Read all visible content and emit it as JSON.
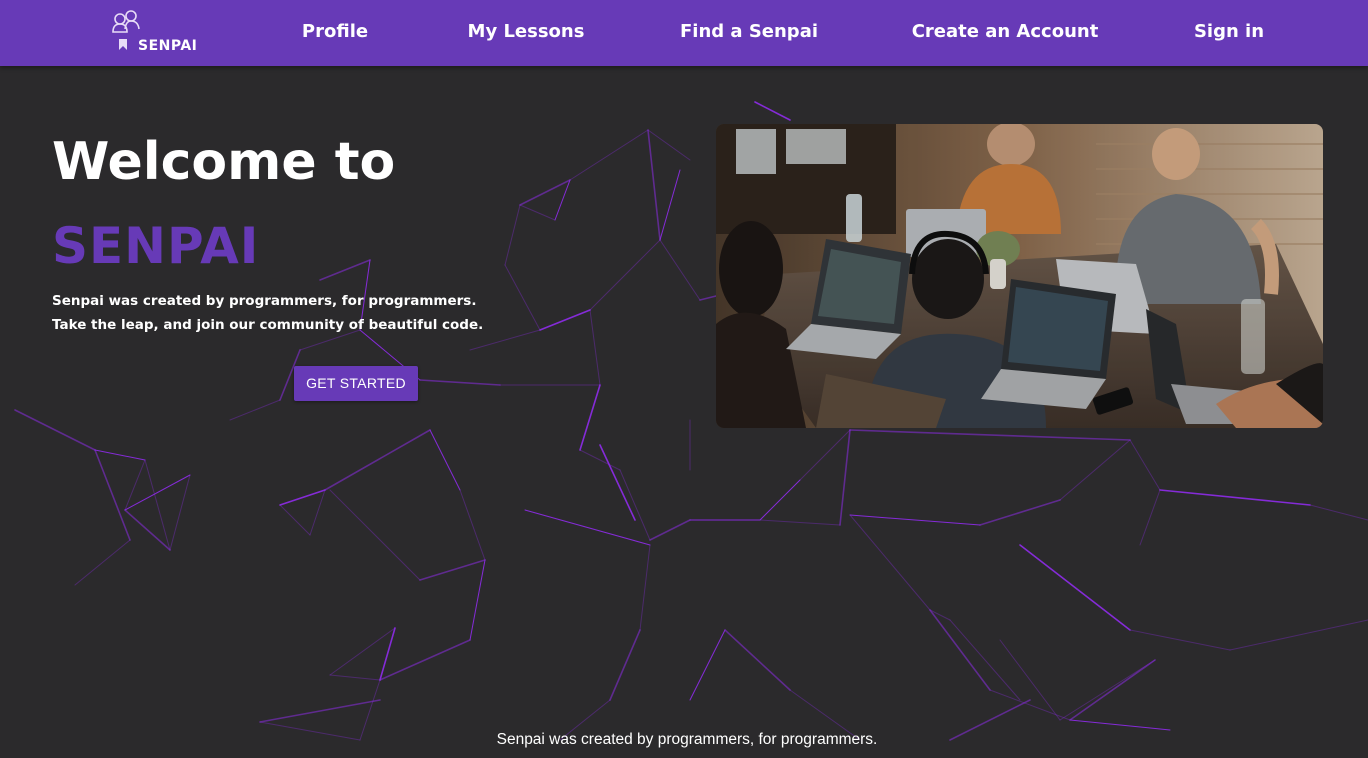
{
  "nav": {
    "logo_text": "SENPAI",
    "links": [
      {
        "label": "Profile"
      },
      {
        "label": "My Lessons"
      },
      {
        "label": "Find a Senpai"
      },
      {
        "label": "Create an Account"
      },
      {
        "label": "Sign in"
      }
    ]
  },
  "hero": {
    "heading": "Welcome to",
    "brand": "SENPAI",
    "tagline_line1": "Senpai was created by programmers, for programmers.",
    "tagline_line2": "Take the leap, and join our community of beautiful code.",
    "cta_label": "GET STARTED",
    "image_subject": "people working on laptops around a table"
  },
  "footer": {
    "text": "Senpai was created by programmers, for programmers."
  },
  "colors": {
    "brand_purple": "#673ab7",
    "background": "#2b2a2c",
    "text": "#ffffff",
    "network_line": "#8a2be2"
  }
}
